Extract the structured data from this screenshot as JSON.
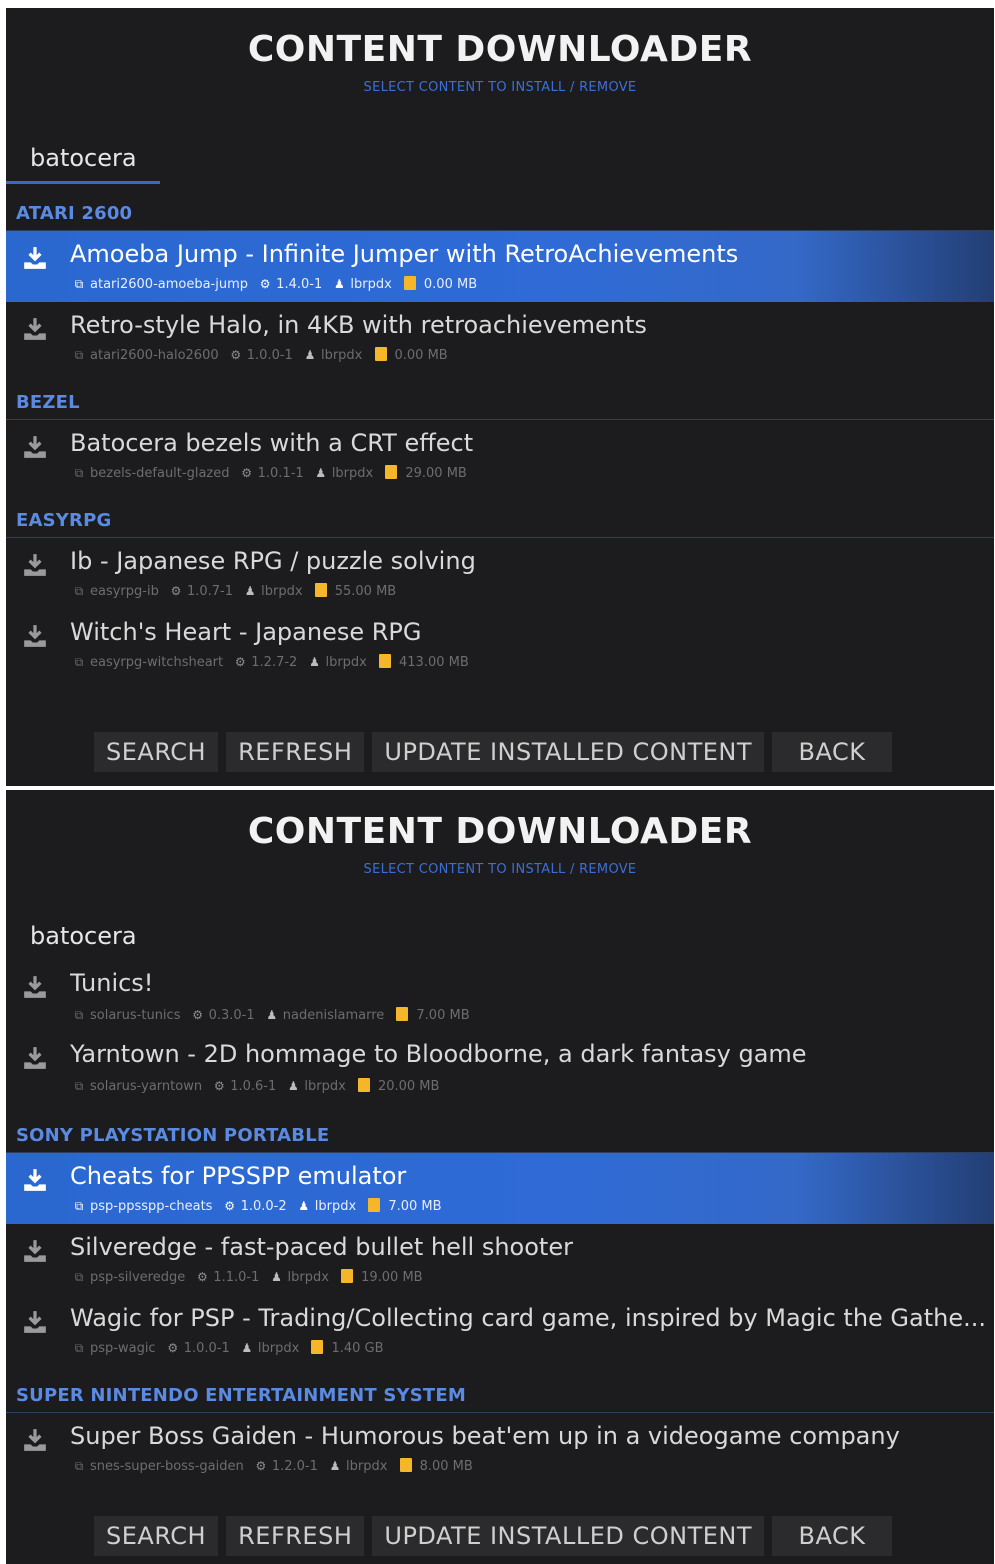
{
  "screens": [
    {
      "header": {
        "title": "CONTENT DOWNLOADER",
        "subtitle": "SELECT CONTENT TO INSTALL / REMOVE"
      },
      "filter_tab": "batocera",
      "sections": [
        {
          "name": "ATARI 2600",
          "items": [
            {
              "title": "Amoeba Jump - Infinite Jumper with RetroAchievements",
              "package": "atari2600-amoeba-jump",
              "version": "1.4.0-1",
              "author": "lbrpdx",
              "size": "0.00 MB",
              "selected": true
            },
            {
              "title": "Retro-style Halo, in 4KB with retroachievements",
              "package": "atari2600-halo2600",
              "version": "1.0.0-1",
              "author": "lbrpdx",
              "size": "0.00 MB",
              "selected": false
            }
          ]
        },
        {
          "name": "BEZEL",
          "items": [
            {
              "title": "Batocera bezels with a CRT effect",
              "package": "bezels-default-glazed",
              "version": "1.0.1-1",
              "author": "lbrpdx",
              "size": "29.00 MB",
              "selected": false
            }
          ]
        },
        {
          "name": "EASYRPG",
          "items": [
            {
              "title": "Ib - Japanese RPG / puzzle solving",
              "package": "easyrpg-ib",
              "version": "1.0.7-1",
              "author": "lbrpdx",
              "size": "55.00 MB",
              "selected": false
            },
            {
              "title": "Witch's Heart - Japanese RPG",
              "package": "easyrpg-witchsheart",
              "version": "1.2.7-2",
              "author": "lbrpdx",
              "size": "413.00 MB",
              "selected": false
            }
          ]
        }
      ],
      "buttons": {
        "search": "SEARCH",
        "refresh": "REFRESH",
        "update": "UPDATE INSTALLED CONTENT",
        "back": "BACK"
      }
    },
    {
      "header": {
        "title": "CONTENT DOWNLOADER",
        "subtitle": "SELECT CONTENT TO INSTALL / REMOVE"
      },
      "filter_tab": "batocera",
      "top_items": [
        {
          "title": "Tunics!",
          "package": "solarus-tunics",
          "version": "0.3.0-1",
          "author": "nadenislamarre",
          "size": "7.00 MB",
          "selected": false
        },
        {
          "title": "Yarntown - 2D hommage to Bloodborne, a dark fantasy game",
          "package": "solarus-yarntown",
          "version": "1.0.6-1",
          "author": "lbrpdx",
          "size": "20.00 MB",
          "selected": false
        }
      ],
      "sections": [
        {
          "name": "SONY PLAYSTATION PORTABLE",
          "items": [
            {
              "title": "Cheats for PPSSPP emulator",
              "package": "psp-ppsspp-cheats",
              "version": "1.0.0-2",
              "author": "lbrpdx",
              "size": "7.00 MB",
              "selected": true
            },
            {
              "title": "Silveredge - fast-paced bullet hell shooter",
              "package": "psp-silveredge",
              "version": "1.1.0-1",
              "author": "lbrpdx",
              "size": "19.00 MB",
              "selected": false
            },
            {
              "title": "Wagic for PSP - Trading/Collecting card game, inspired by Magic the Gathe...",
              "package": "psp-wagic",
              "version": "1.0.0-1",
              "author": "lbrpdx",
              "size": "1.40 GB",
              "selected": false
            }
          ]
        },
        {
          "name": "SUPER NINTENDO ENTERTAINMENT SYSTEM",
          "items": [
            {
              "title": "Super Boss Gaiden - Humorous beat'em up in a videogame company",
              "package": "snes-super-boss-gaiden",
              "version": "1.2.0-1",
              "author": "lbrpdx",
              "size": "8.00 MB",
              "selected": false
            }
          ]
        }
      ],
      "buttons": {
        "search": "SEARCH",
        "refresh": "REFRESH",
        "update": "UPDATE INSTALLED CONTENT",
        "back": "BACK"
      }
    }
  ],
  "icons": {
    "download": "download-icon",
    "package": "package-icon",
    "version": "gears-icon",
    "author": "user-icon",
    "size": "storage-icon"
  },
  "colors": {
    "background": "#1c1c1e",
    "accent": "#3b68c4",
    "section_header": "#5b8ae3",
    "selection": "#2f6ad6",
    "size_icon": "#f5b62a"
  }
}
